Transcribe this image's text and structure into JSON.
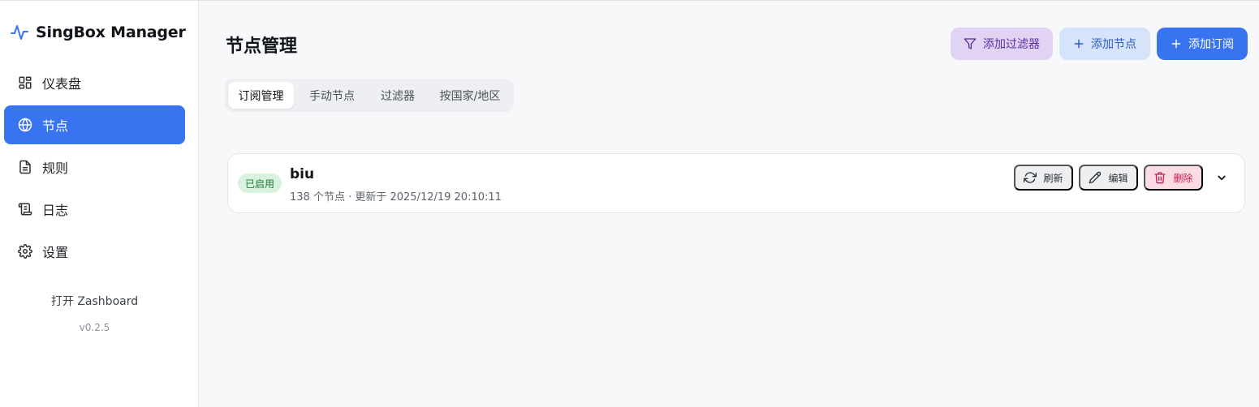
{
  "app": {
    "brand_title": "SingBox Manager",
    "accent_color": "#3874f0"
  },
  "sidebar": {
    "items": [
      {
        "label": "仪表盘",
        "icon": "dashboard-grid-icon"
      },
      {
        "label": "节点",
        "icon": "globe-icon",
        "active": true
      },
      {
        "label": "规则",
        "icon": "document-icon"
      },
      {
        "label": "日志",
        "icon": "scroll-icon"
      },
      {
        "label": "设置",
        "icon": "gear-icon"
      }
    ],
    "zashboard_link": "打开 Zashboard",
    "version": "v0.2.5"
  },
  "header": {
    "title": "节点管理",
    "actions": {
      "add_filter": "添加过滤器",
      "add_node": "添加节点",
      "add_subscription": "添加订阅"
    }
  },
  "tabs": [
    {
      "label": "订阅管理",
      "active": true
    },
    {
      "label": "手动节点"
    },
    {
      "label": "过滤器"
    },
    {
      "label": "按国家/地区"
    }
  ],
  "subscriptions": [
    {
      "status": "已启用",
      "name": "biu",
      "meta": "138 个节点 · 更新于 2025/12/19 20:10:11",
      "actions": {
        "refresh": "刷新",
        "edit": "编辑",
        "delete": "删除"
      }
    }
  ]
}
